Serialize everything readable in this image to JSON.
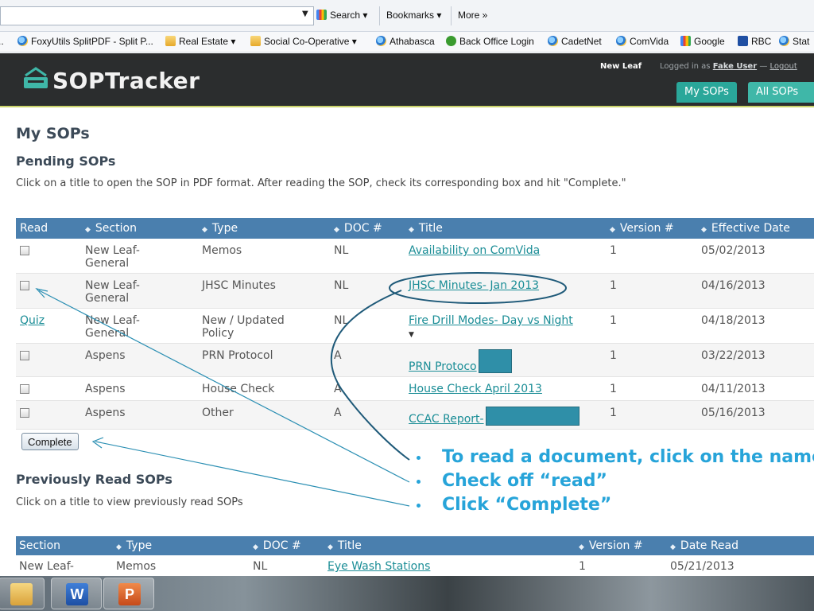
{
  "browser": {
    "search_label": "Search",
    "bookmarks_label": "Bookmarks",
    "more_label": "More »",
    "bookmarks": [
      {
        "label": "FoxyUtils SplitPDF - Split P...",
        "icon": "ie-icon"
      },
      {
        "label": "Real Estate ▾",
        "icon": "folder-icon"
      },
      {
        "label": "Social Co-Operative ▾",
        "icon": "folder-icon"
      },
      {
        "label": "Athabasca",
        "icon": "ie-icon"
      },
      {
        "label": "Back Office Login",
        "icon": "green-figure-icon"
      },
      {
        "label": "CadetNet",
        "icon": "ie-icon"
      },
      {
        "label": "ComVida",
        "icon": "ie-icon"
      },
      {
        "label": "Google",
        "icon": "google-icon"
      },
      {
        "label": "RBC",
        "icon": "rbc-icon"
      },
      {
        "label": "Stat",
        "icon": "ie-icon"
      }
    ]
  },
  "header": {
    "logo_text": "SOPTracker",
    "org_name": "New Leaf",
    "logged_in_prefix": "Logged in as",
    "user_name": "Fake User",
    "logout_separator": " — ",
    "logout_label": "Logout",
    "tabs": [
      "My SOPs",
      "All SOPs"
    ]
  },
  "main": {
    "title": "My SOPs",
    "pending": {
      "heading": "Pending SOPs",
      "instructions": "Click on a title to open the SOP in PDF format. After reading the SOP, check its corresponding box and hit \"Complete.\"",
      "columns": [
        "Read",
        "Section",
        "Type",
        "DOC #",
        "Title",
        "Version #",
        "Effective Date"
      ],
      "rows": [
        {
          "read": "checkbox",
          "section": "New Leaf-\nGeneral",
          "type": "Memos",
          "doc": "NL",
          "title": "Availability on ComVida",
          "version": "1",
          "date": "05/02/2013"
        },
        {
          "read": "checkbox",
          "section": "New Leaf-\nGeneral",
          "type": "JHSC Minutes",
          "doc": "NL",
          "title": "JHSC Minutes- Jan 2013",
          "version": "1",
          "date": "04/16/2013"
        },
        {
          "read": "Quiz",
          "section": "New Leaf-\nGeneral",
          "type": "New / Updated\nPolicy",
          "doc": "NL",
          "title": "Fire Drill Modes- Day vs Night",
          "version": "1",
          "date": "04/18/2013"
        },
        {
          "read": "checkbox",
          "section": "Aspens",
          "type": "PRN Protocol",
          "doc": "A",
          "title": "PRN Protoco",
          "version": "1",
          "date": "03/22/2013"
        },
        {
          "read": "checkbox",
          "section": "Aspens",
          "type": "House Check",
          "doc": "A",
          "title": "House Check April 2013",
          "version": "1",
          "date": "04/11/2013"
        },
        {
          "read": "checkbox",
          "section": "Aspens",
          "type": "Other",
          "doc": "A",
          "title": "CCAC Report-",
          "version": "1",
          "date": "05/16/2013"
        }
      ],
      "complete_label": "Complete"
    },
    "previous": {
      "heading": "Previously Read SOPs",
      "instructions": "Click on a title to view previously read SOPs",
      "columns": [
        "Section",
        "Type",
        "DOC #",
        "Title",
        "Version #",
        "Date Read"
      ],
      "rows": [
        {
          "section": "New Leaf-",
          "type": "Memos",
          "doc": "NL",
          "title": "Eye Wash Stations",
          "version": "1",
          "date": "05/21/2013"
        }
      ]
    }
  },
  "annotations": {
    "notes": [
      "To read a document, click on the name",
      "Check off “read”",
      "Click “Complete”"
    ],
    "color": "#27a4d9"
  },
  "taskbar": {
    "apps": [
      {
        "name": "file-explorer-icon",
        "letter": ""
      },
      {
        "name": "word-icon",
        "letter": "W"
      },
      {
        "name": "powerpoint-icon",
        "letter": "P"
      }
    ]
  }
}
